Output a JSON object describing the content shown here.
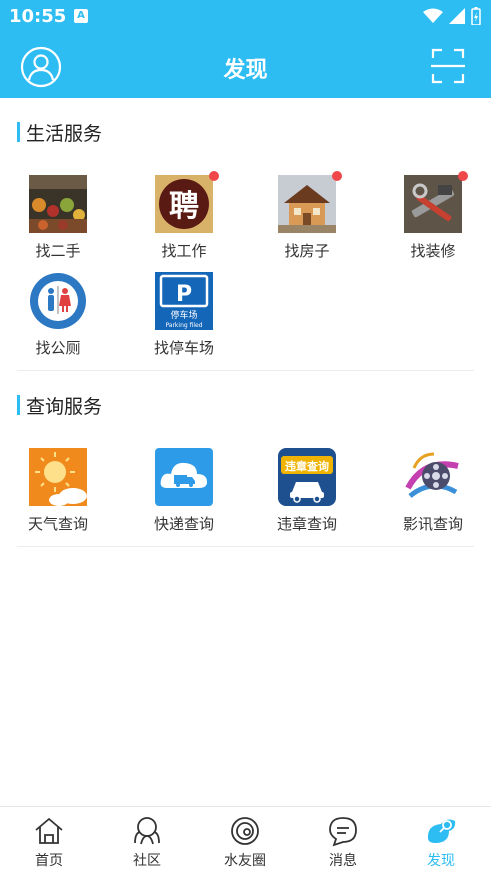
{
  "status_bar": {
    "time": "10:55",
    "notification_badge": "A"
  },
  "header": {
    "title": "发现"
  },
  "sections": [
    {
      "title": "生活服务",
      "items": [
        {
          "label": "找二手",
          "icon": "secondhand-market-icon",
          "badge": false
        },
        {
          "label": "找工作",
          "icon": "job-recruit-icon",
          "badge": true
        },
        {
          "label": "找房子",
          "icon": "house-icon",
          "badge": true
        },
        {
          "label": "找装修",
          "icon": "tools-icon",
          "badge": true
        },
        {
          "label": "找公厕",
          "icon": "restroom-icon",
          "badge": false
        },
        {
          "label": "找停车场",
          "icon": "parking-icon",
          "badge": false
        }
      ]
    },
    {
      "title": "查询服务",
      "items": [
        {
          "label": "天气查询",
          "icon": "weather-icon",
          "badge": false
        },
        {
          "label": "快递查询",
          "icon": "delivery-truck-icon",
          "badge": false
        },
        {
          "label": "违章查询",
          "icon": "traffic-violation-icon",
          "badge": false
        },
        {
          "label": "影讯查询",
          "icon": "film-reel-icon",
          "badge": false
        }
      ]
    }
  ],
  "icon_text": {
    "job": "聘",
    "parking_letter": "P",
    "parking_cn": "停车场",
    "parking_en": "Parking filed",
    "violation": "违章查询"
  },
  "tabs": [
    {
      "label": "首页",
      "icon": "home-icon",
      "active": false
    },
    {
      "label": "社区",
      "icon": "community-icon",
      "active": false
    },
    {
      "label": "水友圈",
      "icon": "circle-icon",
      "active": false
    },
    {
      "label": "消息",
      "icon": "message-icon",
      "active": false
    },
    {
      "label": "发现",
      "icon": "discover-icon",
      "active": true
    }
  ],
  "colors": {
    "accent": "#2ebdf2",
    "badge": "#f0474a"
  }
}
